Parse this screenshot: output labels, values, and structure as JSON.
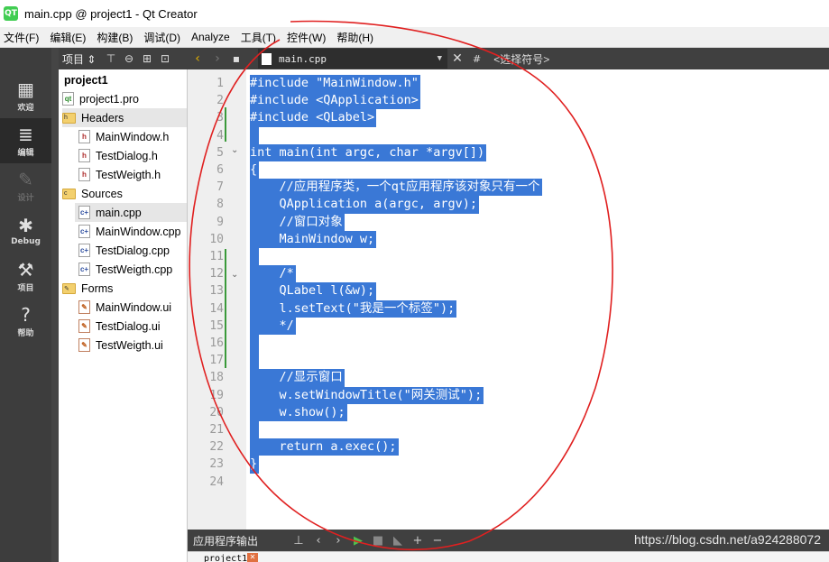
{
  "window": {
    "title": "main.cpp @ project1 - Qt Creator",
    "app_icon": "QT"
  },
  "menu": [
    "文件(F)",
    "编辑(E)",
    "构建(B)",
    "调试(D)",
    "Analyze",
    "工具(T)",
    "控件(W)",
    "帮助(H)"
  ],
  "modes": [
    {
      "label": "欢迎",
      "icon": "grid-icon",
      "glyph": "▦"
    },
    {
      "label": "编辑",
      "icon": "document-icon",
      "glyph": "≣"
    },
    {
      "label": "设计",
      "icon": "pencil-icon",
      "glyph": "✎"
    },
    {
      "label": "Debug",
      "icon": "bug-icon",
      "glyph": "✱"
    },
    {
      "label": "项目",
      "icon": "wrench-icon",
      "glyph": "⚒"
    },
    {
      "label": "帮助",
      "icon": "help-icon",
      "glyph": "?"
    }
  ],
  "project_panel": {
    "view_label": "项目",
    "tree": {
      "root": "project1",
      "pro_file": "project1.pro",
      "headers": {
        "label": "Headers",
        "files": [
          "MainWindow.h",
          "TestDialog.h",
          "TestWeigth.h"
        ]
      },
      "sources": {
        "label": "Sources",
        "files": [
          "main.cpp",
          "MainWindow.cpp",
          "TestDialog.cpp",
          "TestWeigth.cpp"
        ]
      },
      "forms": {
        "label": "Forms",
        "files": [
          "MainWindow.ui",
          "TestDialog.ui",
          "TestWeigth.ui"
        ]
      }
    }
  },
  "editor": {
    "current_file": "main.cpp",
    "symbol_hash": "#",
    "symbol_placeholder": "<选择符号>",
    "line_numbers": [
      "1",
      "2",
      "3",
      "4",
      "5",
      "6",
      "7",
      "8",
      "9",
      "10",
      "11",
      "12",
      "13",
      "14",
      "15",
      "16",
      "17",
      "18",
      "19",
      "20",
      "21",
      "22",
      "23",
      "24"
    ],
    "lines": [
      "#include \"MainWindow.h\"",
      "#include <QApplication>",
      "#include <QLabel>",
      "",
      "int main(int argc, char *argv[])",
      "{",
      "    //应用程序类，一个qt应用程序该对象只有一个",
      "    QApplication a(argc, argv);",
      "    //窗口对象",
      "    MainWindow w;",
      "",
      "    /*",
      "    QLabel l(&w);",
      "    l.setText(\"我是一个标签\");",
      "    */",
      "",
      "",
      "    //显示窗口",
      "    w.setWindowTitle(\"网关测试\");",
      "    w.show();",
      "",
      "    return a.exec();",
      "}",
      ""
    ]
  },
  "output": {
    "title": "应用程序输出",
    "tab_label": "project1",
    "watermark": "https://blog.csdn.net/a924288072"
  },
  "colors": {
    "selection": "#3a78d6",
    "sidebar": "#3d3d3d",
    "toolbar": "#404040",
    "annotation": "#e02020"
  }
}
